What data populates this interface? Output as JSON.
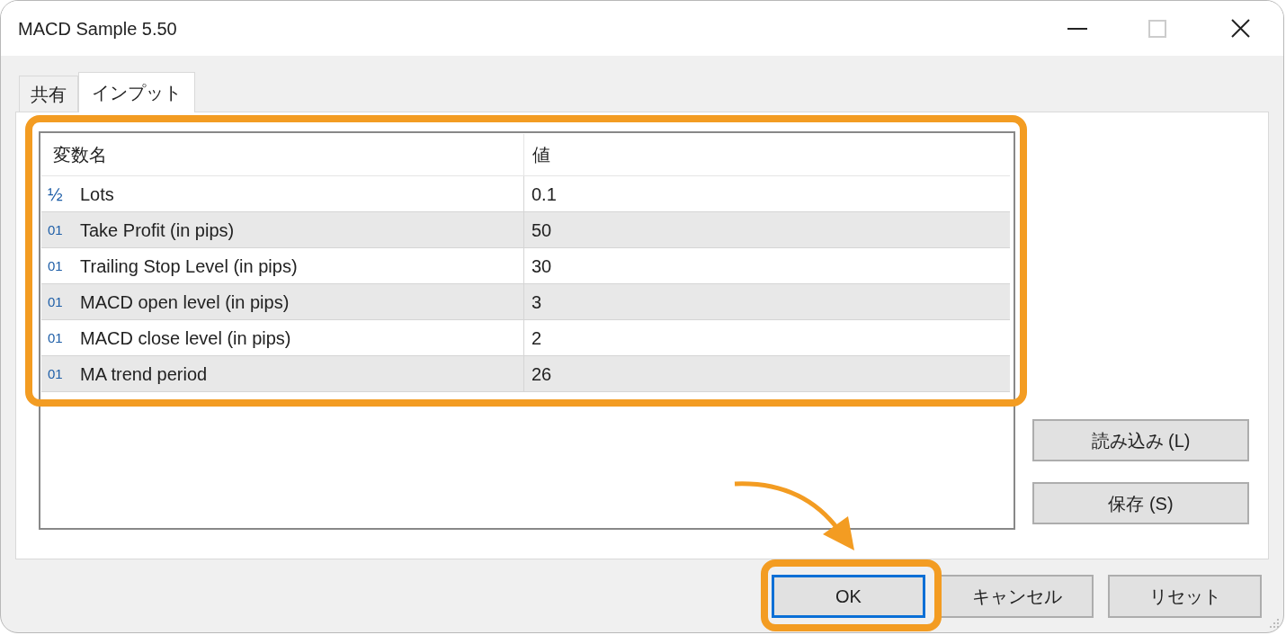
{
  "window": {
    "title": "MACD Sample 5.50"
  },
  "tabs": [
    {
      "label": "共有",
      "selected": false
    },
    {
      "label": "インプット",
      "selected": true
    }
  ],
  "table": {
    "columns": [
      "変数名",
      "値"
    ],
    "rows": [
      {
        "kind": "double",
        "badge": "½",
        "name": "Lots",
        "value": "0.1"
      },
      {
        "kind": "integer",
        "badge": "01",
        "name": "Take Profit (in pips)",
        "value": "50"
      },
      {
        "kind": "integer",
        "badge": "01",
        "name": "Trailing Stop Level (in pips)",
        "value": "30"
      },
      {
        "kind": "integer",
        "badge": "01",
        "name": "MACD open level (in pips)",
        "value": "3"
      },
      {
        "kind": "integer",
        "badge": "01",
        "name": "MACD close level (in pips)",
        "value": "2"
      },
      {
        "kind": "integer",
        "badge": "01",
        "name": "MA trend period",
        "value": "26"
      }
    ]
  },
  "side_buttons": [
    "読み込み (L)",
    "保存 (S)"
  ],
  "footer_buttons": [
    {
      "label": "OK",
      "selected": true
    },
    {
      "label": "キャンセル",
      "selected": false
    },
    {
      "label": "リセット",
      "selected": false
    }
  ]
}
